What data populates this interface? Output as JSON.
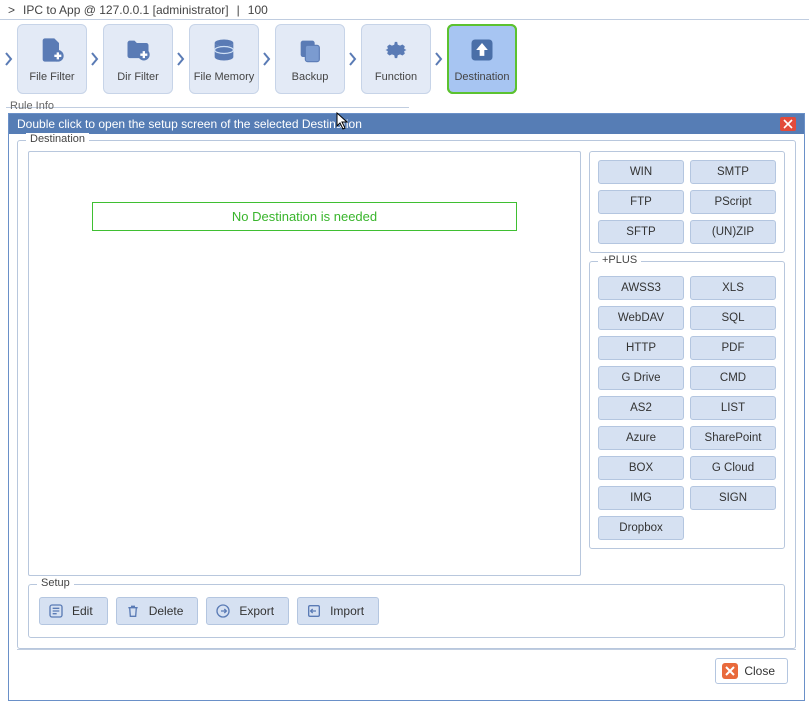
{
  "top": {
    "breadcrumb_prefix": ">",
    "title": "IPC to App @ 127.0.0.1 [administrator]",
    "sep": "|",
    "number": "100"
  },
  "steps": [
    {
      "label": "File Filter",
      "name": "step-file-filter"
    },
    {
      "label": "Dir Filter",
      "name": "step-dir-filter"
    },
    {
      "label": "File Memory",
      "name": "step-file-memory"
    },
    {
      "label": "Backup",
      "name": "step-backup"
    },
    {
      "label": "Function",
      "name": "step-function"
    },
    {
      "label": "Destination",
      "name": "step-destination"
    }
  ],
  "rule_info_label": "Rule Info",
  "dialog": {
    "header": "Double click to open the setup screen of the selected Destination",
    "destination_legend": "Destination",
    "no_destination": "No Destination is needed",
    "basic_buttons": [
      "WIN",
      "SMTP",
      "FTP",
      "PScript",
      "SFTP",
      "(UN)ZIP"
    ],
    "plus_legend": "+PLUS",
    "plus_buttons": [
      "AWSS3",
      "XLS",
      "WebDAV",
      "SQL",
      "HTTP",
      "PDF",
      "G Drive",
      "CMD",
      "AS2",
      "LIST",
      "Azure",
      "SharePoint",
      "BOX",
      "G Cloud",
      "IMG",
      "SIGN",
      "Dropbox"
    ],
    "setup_legend": "Setup",
    "setup_buttons": {
      "edit": "Edit",
      "delete": "Delete",
      "export": "Export",
      "import": "Import"
    },
    "close": "Close"
  }
}
